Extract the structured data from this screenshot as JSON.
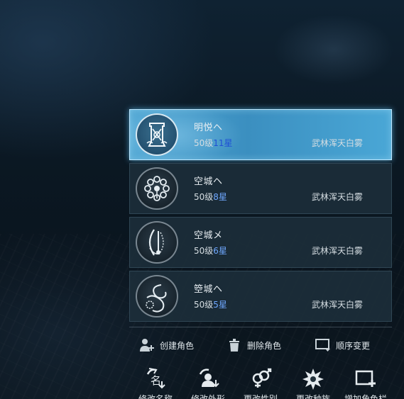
{
  "characters": [
    {
      "name": "明悦ヘ",
      "level": "50级",
      "stars": "11星",
      "server": "武林浑天白雾",
      "emblem": "scroll-crest-icon",
      "selected": true
    },
    {
      "name": "空城ヘ",
      "level": "50级",
      "stars": "8星",
      "server": "武林浑天白雾",
      "emblem": "flower-ring-icon",
      "selected": false
    },
    {
      "name": "空城メ",
      "level": "50级",
      "stars": "6星",
      "server": "武林浑天白雾",
      "emblem": "blade-crest-icon",
      "selected": false
    },
    {
      "name": "箜城ヘ",
      "level": "50级",
      "stars": "5星",
      "server": "武林浑天白雾",
      "emblem": "swirl-crest-icon",
      "selected": false
    }
  ],
  "actions": {
    "create": "创建角色",
    "delete": "删除角色",
    "reorder": "顺序变更"
  },
  "bottom_buttons": [
    {
      "label": "修改名称",
      "icon": "rename-icon"
    },
    {
      "label": "修改外形",
      "icon": "change-appearance-icon"
    },
    {
      "label": "更改性别",
      "icon": "gender-icon"
    },
    {
      "label": "更改种族",
      "icon": "race-icon"
    },
    {
      "label": "增加角色栏",
      "icon": "add-slot-icon"
    }
  ],
  "colors": {
    "selected_card": "#4aa7d6",
    "card": "#1c2e3a",
    "star_text": "#6fa8ff"
  }
}
